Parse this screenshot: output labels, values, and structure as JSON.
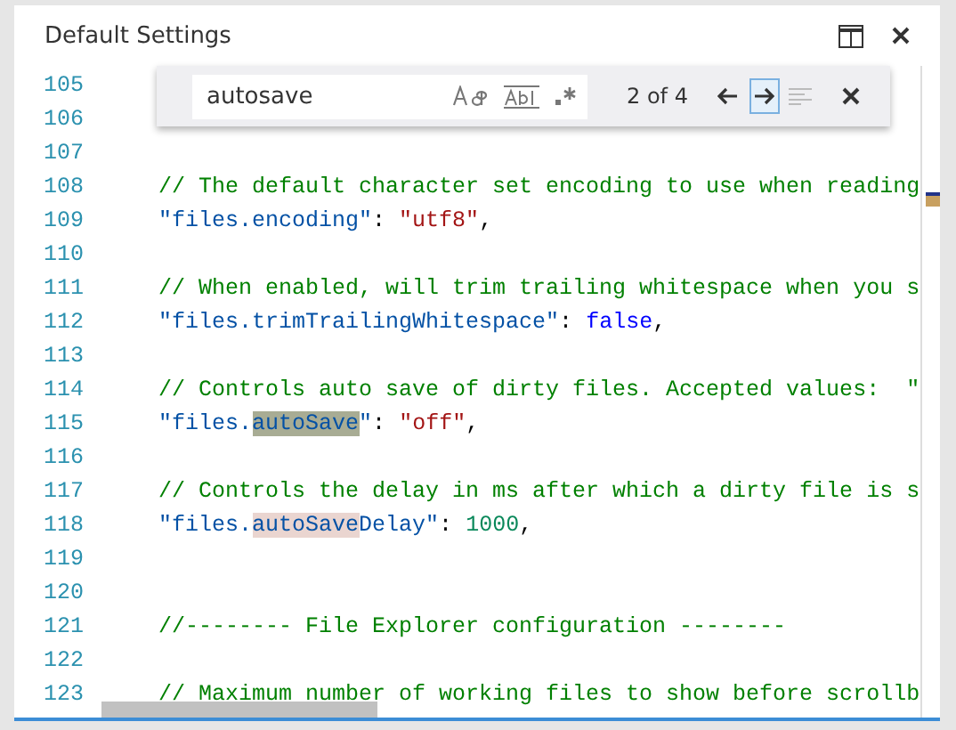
{
  "window": {
    "title": "Default Settings"
  },
  "find_widget": {
    "value": "autosave",
    "match_case": false,
    "whole_word": false,
    "regex": false,
    "count": "2 of 4",
    "next_focused": true,
    "selection_only_disabled": true
  },
  "lines": [
    {
      "number": "105"
    },
    {
      "number": "106"
    },
    {
      "number": "107"
    },
    {
      "number": "108",
      "tokens": [
        {
          "text": "// The default character set encoding to use when reading",
          "kind": "comment"
        }
      ]
    },
    {
      "number": "109",
      "tokens": [
        {
          "text": "\"files.encoding\"",
          "kind": "key"
        },
        {
          "text": ": ",
          "kind": "punct"
        },
        {
          "text": "\"utf8\"",
          "kind": "string"
        },
        {
          "text": ",",
          "kind": "punct"
        }
      ]
    },
    {
      "number": "110"
    },
    {
      "number": "111",
      "tokens": [
        {
          "text": "// When enabled, will trim trailing whitespace when you s",
          "kind": "comment"
        }
      ]
    },
    {
      "number": "112",
      "tokens": [
        {
          "text": "\"files.trimTrailingWhitespace\"",
          "kind": "key"
        },
        {
          "text": ": ",
          "kind": "punct"
        },
        {
          "text": "false",
          "kind": "keyword"
        },
        {
          "text": ",",
          "kind": "punct"
        }
      ]
    },
    {
      "number": "113"
    },
    {
      "number": "114",
      "tokens": [
        {
          "text": "// Controls auto save of dirty files. Accepted values:  \"",
          "kind": "comment"
        }
      ]
    },
    {
      "number": "115",
      "tokens": [
        {
          "text": "\"files.",
          "kind": "key"
        },
        {
          "text": "autoSave",
          "kind": "key",
          "match": true,
          "current": true
        },
        {
          "text": "\"",
          "kind": "key"
        },
        {
          "text": ": ",
          "kind": "punct"
        },
        {
          "text": "\"off\"",
          "kind": "string"
        },
        {
          "text": ",",
          "kind": "punct"
        }
      ]
    },
    {
      "number": "116"
    },
    {
      "number": "117",
      "tokens": [
        {
          "text": "// Controls the delay in ms after which a dirty file is s",
          "kind": "comment"
        }
      ]
    },
    {
      "number": "118",
      "tokens": [
        {
          "text": "\"files.",
          "kind": "key"
        },
        {
          "text": "autoSave",
          "kind": "key",
          "match": true,
          "current": false
        },
        {
          "text": "Delay\"",
          "kind": "key"
        },
        {
          "text": ": ",
          "kind": "punct"
        },
        {
          "text": "1000",
          "kind": "number"
        },
        {
          "text": ",",
          "kind": "punct"
        }
      ]
    },
    {
      "number": "119"
    },
    {
      "number": "120"
    },
    {
      "number": "121",
      "tokens": [
        {
          "text": "//-------- File Explorer configuration --------",
          "kind": "comment"
        }
      ]
    },
    {
      "number": "122"
    },
    {
      "number": "123",
      "tokens": [
        {
          "text": "// Maximum number of working files to show before scrollb",
          "kind": "comment"
        }
      ]
    }
  ]
}
